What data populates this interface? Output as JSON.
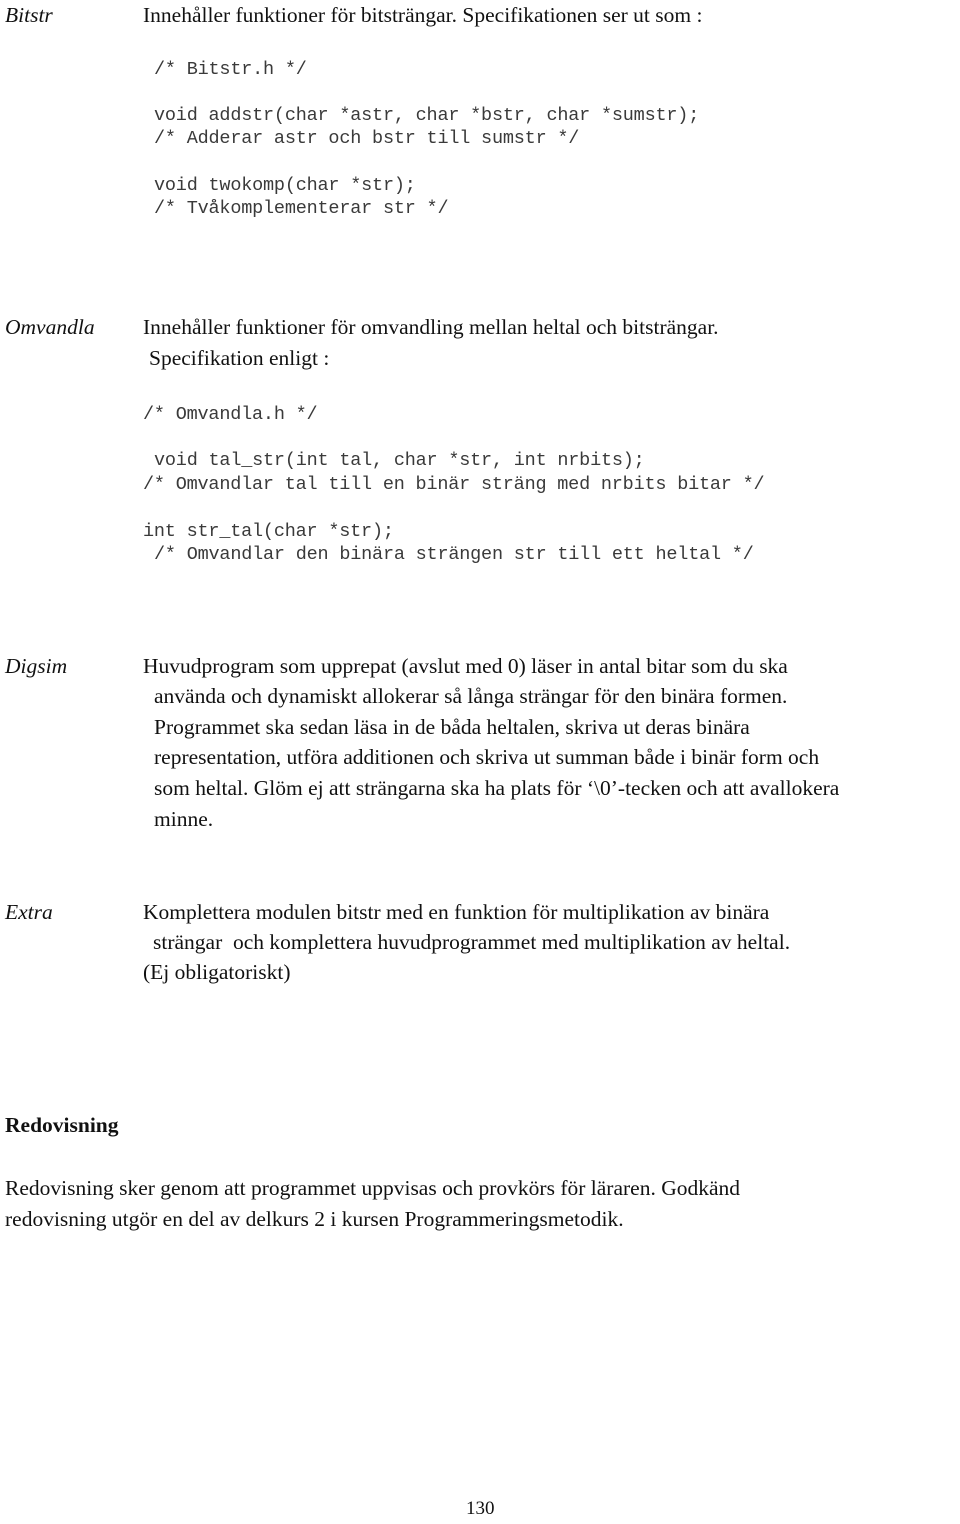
{
  "sections": [
    {
      "label": "Bitstr",
      "description": [
        "Innehåller funktioner för bitsträngar. Specifikationen ser ut som :"
      ],
      "code": [
        "/* Bitstr.h */",
        "void addstr(char *astr, char *bstr, char *sumstr);",
        "/* Adderar astr och bstr till sumstr */",
        "void twokomp(char *str);",
        "/* Tvåkomplementerar str */"
      ]
    },
    {
      "label": "Omvandla",
      "description": [
        "Innehåller funktioner för omvandling mellan heltal och bitsträngar.",
        "Specifikation enligt :"
      ],
      "code": [
        "/* Omvandla.h */",
        "void tal_str(int tal, char *str, int nrbits);",
        "/* Omvandlar tal till en binär sträng med nrbits bitar */",
        "int str_tal(char *str);",
        "/* Omvandlar den binära strängen str till ett heltal */"
      ]
    },
    {
      "label": "Digsim",
      "description": [
        "Huvudprogram som upprepat (avslut med 0) läser in antal bitar som du ska",
        "använda och dynamiskt allokerar så långa strängar för den binära formen.",
        "Programmet ska sedan läsa in de båda heltalen, skriva ut deras binära",
        "representation, utföra additionen och skriva ut summan både i binär form och",
        "som heltal. Glöm ej att strängarna ska ha plats för ‘\\0’-tecken och att avallokera",
        "minne."
      ]
    },
    {
      "label": "Extra",
      "description": [
        "Komplettera modulen bitstr med en funktion för multiplikation av binära",
        "strängar  och komplettera huvudprogrammet med multiplikation av heltal.",
        "(Ej obligatoriskt)"
      ]
    }
  ],
  "redovisning": {
    "heading": "Redovisning",
    "lines": [
      "Redovisning sker genom att programmet uppvisas och provkörs för läraren. Godkänd",
      "redovisning utgör en del av delkurs 2 i kursen Programmeringsmetodik."
    ]
  },
  "page_number": "130"
}
